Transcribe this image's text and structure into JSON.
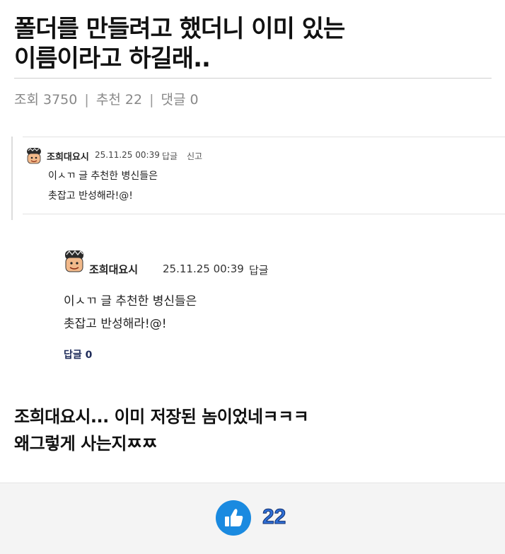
{
  "post": {
    "title_line1": "폴더를 만들려고 했더니 이미 있는",
    "title_line2": "이름이라고 하길래..",
    "meta": {
      "views": "조회 3750",
      "recommends": "추천 22",
      "comments": "댓글 0",
      "separator": "|"
    }
  },
  "screenshot1": {
    "author": "조희대요시",
    "date": "25.11.25 00:39",
    "reply_label": "답글",
    "report_label": "신고",
    "text_line1": "이ㅅㄲ 글 추천한 병신들은",
    "text_line2": "촛잡고 반성해라!@!"
  },
  "screenshot2": {
    "author": "조희대요시",
    "date": "25.11.25 00:39",
    "reply_label": "답글",
    "text_line1": "이ㅅㄲ 글 추천한 병신들은",
    "text_line2": "촛잡고 반성해라!@!",
    "reply_count": "답글 0"
  },
  "body": {
    "line1": "조희대요시... 이미 저장된 놈이었네ㅋㅋㅋ",
    "line2": "왜그렇게 사는지ㅉㅉ"
  },
  "footer": {
    "like_icon": "thumbs-up-icon",
    "like_count": "22",
    "colors": {
      "like_button": "#1a8ae0",
      "like_count": "#2f6fd6"
    }
  }
}
